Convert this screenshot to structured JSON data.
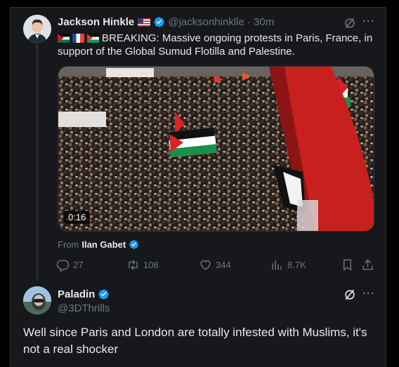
{
  "tweet": {
    "author_name": "Jackson Hinkle",
    "author_handle": "@jacksonhinklle",
    "time": "· 30m",
    "text": "BREAKING: Massive ongoing protests in Paris, France, in support of the Global Sumud Flotilla and Palestine.",
    "flag_icons": [
      "jordan-flag-icon",
      "france-flag-icon",
      "palestine-flag-icon"
    ],
    "video_duration": "0:16",
    "from_label": "From",
    "from_name": "Ilan Gabet",
    "stats": {
      "replies": "27",
      "reposts": "108",
      "likes": "344",
      "views": "8.7K"
    }
  },
  "reply": {
    "author_name": "Paladin",
    "author_handle": "@3DThrills",
    "text": "Well since Paris and London are totally infested with Muslims, it's not a real shocker"
  },
  "colors": {
    "background": "#000000",
    "card": "#16181c",
    "text": "#e7e9ea",
    "muted": "#71767b",
    "verified": "#1d9bf0"
  }
}
